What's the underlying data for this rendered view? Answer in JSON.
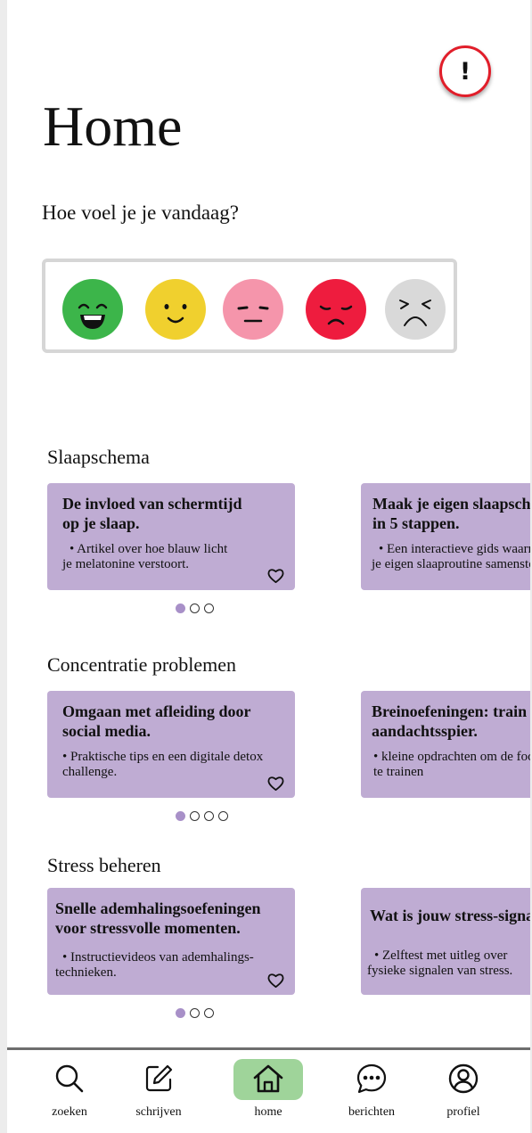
{
  "page": {
    "title": "Home",
    "alert_label": "!"
  },
  "mood": {
    "question": "Hoe voel je je vandaag?",
    "options": [
      {
        "name": "very-happy",
        "color": "#3cb54a"
      },
      {
        "name": "happy",
        "color": "#f0d02e"
      },
      {
        "name": "neutral",
        "color": "#f595ab"
      },
      {
        "name": "sad",
        "color": "#ee1c3e"
      },
      {
        "name": "very-sad",
        "color": "#d9d9d9"
      }
    ]
  },
  "sections": [
    {
      "title": "Slaapschema",
      "cards": [
        {
          "title_lines": [
            "De invloed van schermtijd",
            "op je slaap."
          ],
          "bullet_lines": [
            "•  Artikel over hoe blauw licht",
            "je melatonine verstoort."
          ]
        },
        {
          "title_lines": [
            "Maak je eigen slaapschema",
            "in 5 stappen."
          ],
          "bullet_lines": [
            "•  Een interactieve gids waarmee",
            "je eigen slaaproutine samenstelt."
          ]
        }
      ],
      "pages": 3,
      "active_page": 1
    },
    {
      "title": "Concentratie problemen",
      "cards": [
        {
          "title_lines": [
            "Omgaan met afleiding door",
            "social media."
          ],
          "bullet_lines": [
            "•  Praktische tips en een digitale detox",
            "challenge."
          ]
        },
        {
          "title_lines": [
            "Breinoefeningen: train je",
            "aandachtsspier."
          ],
          "bullet_lines": [
            "•  kleine opdrachten om de focus",
            "te trainen"
          ]
        }
      ],
      "pages": 4,
      "active_page": 1
    },
    {
      "title": "Stress beheren",
      "cards": [
        {
          "title_lines": [
            "Snelle ademhalingsoefeningen",
            "voor stressvolle momenten."
          ],
          "bullet_lines": [
            "•  Instructievideos van ademhalings-",
            "technieken."
          ]
        },
        {
          "title_lines": [
            "Wat is jouw stress-signaal?"
          ],
          "bullet_lines": [
            "•  Zelftest met uitleg over",
            "fysieke signalen van stress."
          ]
        }
      ],
      "pages": 3,
      "active_page": 1
    }
  ],
  "nav": {
    "items": [
      {
        "label": "zoeken",
        "icon": "search-icon"
      },
      {
        "label": "schrijven",
        "icon": "edit-icon"
      },
      {
        "label": "home",
        "icon": "home-icon",
        "active": true
      },
      {
        "label": "berichten",
        "icon": "chat-icon"
      },
      {
        "label": "profiel",
        "icon": "profile-icon"
      }
    ],
    "active_color": "#9fd49a"
  },
  "colors": {
    "card": "#bfacd3",
    "dot_active": "#a890c8",
    "alert_border": "#e11e2a"
  }
}
